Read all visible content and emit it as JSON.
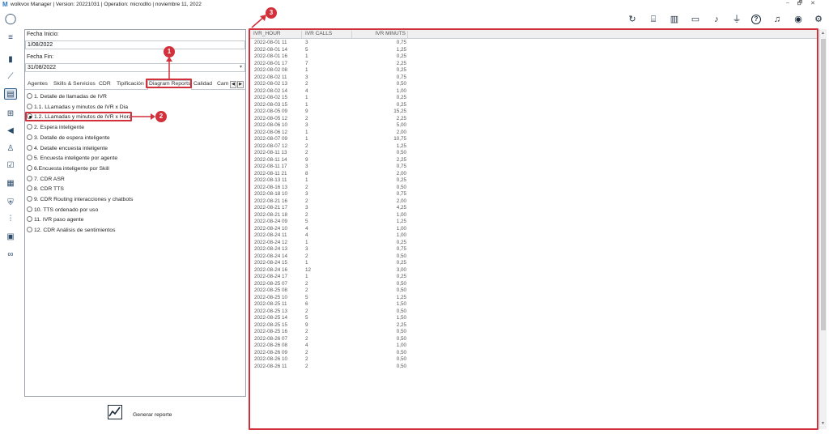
{
  "app": {
    "logo": "M",
    "title": "wolkvox Manager  | Version: 20221031  |  Operation: microdllo | noviembre 11, 2022"
  },
  "window_controls": [
    "–",
    "🗗",
    "✕"
  ],
  "left_rail": [
    {
      "icon": "user-avatar-icon",
      "glyph": "◯"
    },
    {
      "icon": "menu-icon",
      "glyph": "≡"
    },
    {
      "icon": "bar-chart-icon",
      "glyph": "▮"
    },
    {
      "icon": "trend-icon",
      "glyph": "⟋"
    },
    {
      "icon": "reports-icon",
      "glyph": "▤"
    },
    {
      "icon": "flow-icon",
      "glyph": "⊞"
    },
    {
      "icon": "megaphone-icon",
      "glyph": "◀"
    },
    {
      "icon": "agents-group-icon",
      "glyph": "♙"
    },
    {
      "icon": "checklist-icon",
      "glyph": "☑"
    },
    {
      "icon": "calculator-icon",
      "glyph": "▦"
    },
    {
      "icon": "shield-icon",
      "glyph": "⛨"
    },
    {
      "icon": "audio-wave-icon",
      "glyph": "⫶"
    },
    {
      "icon": "video-add-icon",
      "glyph": "▣"
    },
    {
      "icon": "voicemail-icon",
      "glyph": "∞"
    }
  ],
  "top_icons": [
    {
      "icon": "refresh-icon",
      "glyph": "↻"
    },
    {
      "icon": "briefcase-icon",
      "glyph": "⌸"
    },
    {
      "icon": "book-icon",
      "glyph": "▥"
    },
    {
      "icon": "contact-card-icon",
      "glyph": "▭"
    },
    {
      "icon": "music-note-icon",
      "glyph": "♪"
    },
    {
      "icon": "microphone-icon",
      "glyph": "⏚"
    },
    {
      "icon": "help-icon",
      "glyph": "?"
    },
    {
      "icon": "bell-icon",
      "glyph": "♫"
    },
    {
      "icon": "account-icon",
      "glyph": "◉"
    },
    {
      "icon": "settings-icon",
      "glyph": "⚙"
    }
  ],
  "form": {
    "start_label": "Fecha Inicio:",
    "start_value": "1/08/2022",
    "end_label": "Fecha Fin:",
    "end_value": "31/08/2022"
  },
  "tabs": [
    "Agentes",
    "Skills & Servicios",
    "CDR",
    "Tipificación",
    "Diagram Reports",
    "Calidad",
    "Cam"
  ],
  "active_tab": "Diagram Reports",
  "options": [
    {
      "label": "1. Detalle de llamadas de IVR",
      "selected": false
    },
    {
      "label": "1.1. LLamadas y minutos de IVR x Dia",
      "selected": false
    },
    {
      "label": "1.2. LLamadas y minutos de IVR x Hora",
      "selected": true
    },
    {
      "label": "2. Espera inteligente",
      "selected": false
    },
    {
      "label": "3. Detalle de espera inteligente",
      "selected": false
    },
    {
      "label": "4. Detalle encuesta inteligente",
      "selected": false
    },
    {
      "label": "5. Encuesta inteligente por agente",
      "selected": false
    },
    {
      "label": "6.Encuesta inteligente por Skill",
      "selected": false
    },
    {
      "label": "7. CDR ASR",
      "selected": false
    },
    {
      "label": "8. CDR TTS",
      "selected": false
    },
    {
      "label": "9. CDR Routing interacciones y chatbots",
      "selected": false
    },
    {
      "label": "10. TTS ordenado por uso",
      "selected": false
    },
    {
      "label": "11. IVR paso agente",
      "selected": false
    },
    {
      "label": "12. CDR Análisis de sentimientos",
      "selected": false
    }
  ],
  "generate": {
    "label": "Generar reporte",
    "icon": "chart-report-icon"
  },
  "grid": {
    "headers": [
      "IVR_HOUR",
      "IVR CALLS",
      "IVR MINUTS"
    ],
    "rows": [
      [
        "2022-08-01 11",
        "3",
        "0,75"
      ],
      [
        "2022-08-01 14",
        "5",
        "1,25"
      ],
      [
        "2022-08-01 16",
        "1",
        "0,25"
      ],
      [
        "2022-08-01 17",
        "7",
        "2,25"
      ],
      [
        "2022-08-02 08",
        "1",
        "0,25"
      ],
      [
        "2022-08-02 11",
        "3",
        "0,75"
      ],
      [
        "2022-08-02 13",
        "2",
        "0,50"
      ],
      [
        "2022-08-02 14",
        "4",
        "1,00"
      ],
      [
        "2022-08-02 15",
        "1",
        "0,25"
      ],
      [
        "2022-08-03 15",
        "1",
        "0,25"
      ],
      [
        "2022-08-05 09",
        "9",
        "15,25"
      ],
      [
        "2022-08-05 12",
        "2",
        "2,25"
      ],
      [
        "2022-08-06 10",
        "3",
        "5,00"
      ],
      [
        "2022-08-06 12",
        "1",
        "2,00"
      ],
      [
        "2022-08-07 09",
        "1",
        "10,75"
      ],
      [
        "2022-08-07 12",
        "2",
        "1,25"
      ],
      [
        "2022-08-11 13",
        "2",
        "0,50"
      ],
      [
        "2022-08-11 14",
        "9",
        "2,25"
      ],
      [
        "2022-08-11 17",
        "3",
        "0,75"
      ],
      [
        "2022-08-11 21",
        "8",
        "2,00"
      ],
      [
        "2022-08-13 11",
        "1",
        "0,25"
      ],
      [
        "2022-08-16 13",
        "2",
        "0,50"
      ],
      [
        "2022-08-18 10",
        "3",
        "0,75"
      ],
      [
        "2022-08-21 16",
        "2",
        "2,00"
      ],
      [
        "2022-08-21 17",
        "3",
        "4,25"
      ],
      [
        "2022-08-21 18",
        "2",
        "1,00"
      ],
      [
        "2022-08-24 09",
        "5",
        "1,25"
      ],
      [
        "2022-08-24 10",
        "4",
        "1,00"
      ],
      [
        "2022-08-24 11",
        "4",
        "1,00"
      ],
      [
        "2022-08-24 12",
        "1",
        "0,25"
      ],
      [
        "2022-08-24 13",
        "3",
        "0,75"
      ],
      [
        "2022-08-24 14",
        "2",
        "0,50"
      ],
      [
        "2022-08-24 15",
        "1",
        "0,25"
      ],
      [
        "2022-08-24 16",
        "12",
        "3,00"
      ],
      [
        "2022-08-24 17",
        "1",
        "0,25"
      ],
      [
        "2022-08-25 07",
        "2",
        "0,50"
      ],
      [
        "2022-08-25 08",
        "2",
        "0,50"
      ],
      [
        "2022-08-25 10",
        "5",
        "1,25"
      ],
      [
        "2022-08-25 11",
        "6",
        "1,50"
      ],
      [
        "2022-08-25 13",
        "2",
        "0,50"
      ],
      [
        "2022-08-25 14",
        "5",
        "1,50"
      ],
      [
        "2022-08-25 15",
        "9",
        "2,25"
      ],
      [
        "2022-08-25 16",
        "2",
        "0,50"
      ],
      [
        "2022-08-26 07",
        "2",
        "0,50"
      ],
      [
        "2022-08-26 08",
        "4",
        "1,00"
      ],
      [
        "2022-08-26 09",
        "2",
        "0,50"
      ],
      [
        "2022-08-26 10",
        "2",
        "0,50"
      ],
      [
        "2022-08-26 11",
        "2",
        "0,50"
      ]
    ]
  },
  "annotations": [
    "1",
    "2",
    "3"
  ],
  "colors": {
    "highlight": "#d2313b",
    "accent": "#2b78c5"
  }
}
